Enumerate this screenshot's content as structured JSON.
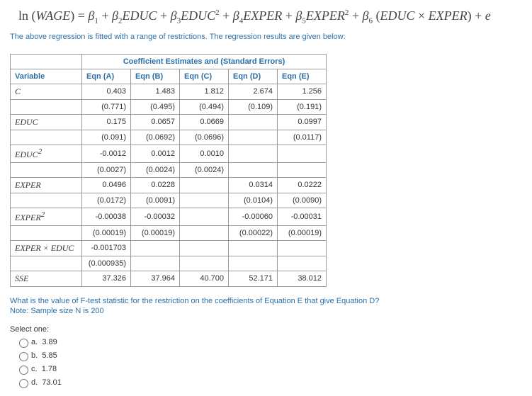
{
  "equation_html": "ln (<i>WAGE</i>) = <i>β</i><sub>1</sub> + <i>β</i><sub>2</sub><i>EDUC</i> + <i>β</i><sub>3</sub><i>EDUC</i><span class='sup'>2</span> + <i>β</i><sub>4</sub><i>EXPER</i> + <i>β</i><sub>5</sub><i>EXPER</i><span class='sup'>2</span> + <i>β</i><sub>6</sub> (<i>EDUC</i> × <i>EXPER</i>) + <i>e</i>",
  "description": "The above regression is fitted with a range of restrictions. The regression results are given below:",
  "table": {
    "header_main": "Coefficient Estimates and (Standard Errors)",
    "header_row": [
      "Variable",
      "Eqn (A)",
      "Eqn (B)",
      "Eqn (C)",
      "Eqn (D)",
      "Eqn (E)"
    ],
    "rows": [
      {
        "var_html": "C",
        "cells": [
          "0.403",
          "1.483",
          "1.812",
          "2.674",
          "1.256"
        ]
      },
      {
        "var_html": "",
        "cells": [
          "(0.771)",
          "(0.495)",
          "(0.494)",
          "(0.109)",
          "(0.191)"
        ]
      },
      {
        "var_html": "EDUC",
        "cells": [
          "0.175",
          "0.0657",
          "0.0669",
          "",
          "0.0997"
        ]
      },
      {
        "var_html": "",
        "cells": [
          "(0.091)",
          "(0.0692)",
          "(0.0696)",
          "",
          "(0.0117)"
        ]
      },
      {
        "var_html": "EDUC<span class='sup'>2</span>",
        "cells": [
          "-0.0012",
          "0.0012",
          "0.0010",
          "",
          ""
        ]
      },
      {
        "var_html": "",
        "cells": [
          "(0.0027)",
          "(0.0024)",
          "(0.0024)",
          "",
          ""
        ]
      },
      {
        "var_html": "EXPER",
        "cells": [
          "0.0496",
          "0.0228",
          "",
          "0.0314",
          "0.0222"
        ]
      },
      {
        "var_html": "",
        "cells": [
          "(0.0172)",
          "(0.0091)",
          "",
          "(0.0104)",
          "(0.0090)"
        ]
      },
      {
        "var_html": "EXPER<span class='sup'>2</span>",
        "cells": [
          "-0.00038",
          "-0.00032",
          "",
          "-0.00060",
          "-0.00031"
        ]
      },
      {
        "var_html": "",
        "cells": [
          "(0.00019)",
          "(0.00019)",
          "",
          "(0.00022)",
          "(0.00019)"
        ]
      },
      {
        "var_html": "EXPER × EDUC",
        "cells": [
          "-0.001703",
          "",
          "",
          "",
          ""
        ]
      },
      {
        "var_html": "",
        "cells": [
          "(0.000935)",
          "",
          "",
          "",
          ""
        ]
      },
      {
        "var_html": "SSE",
        "cells": [
          "37.326",
          "37.964",
          "40.700",
          "52.171",
          "38.012"
        ]
      }
    ]
  },
  "question": "What is the value of F-test statistic for the restriction on the coefficients of Equation E that give Equation D?",
  "note": "Note: Sample size N is 200",
  "select_label": "Select one:",
  "options": [
    {
      "letter": "a.",
      "text": "3.89"
    },
    {
      "letter": "b.",
      "text": "5.85"
    },
    {
      "letter": "c.",
      "text": "1.78"
    },
    {
      "letter": "d.",
      "text": "73.01"
    }
  ]
}
